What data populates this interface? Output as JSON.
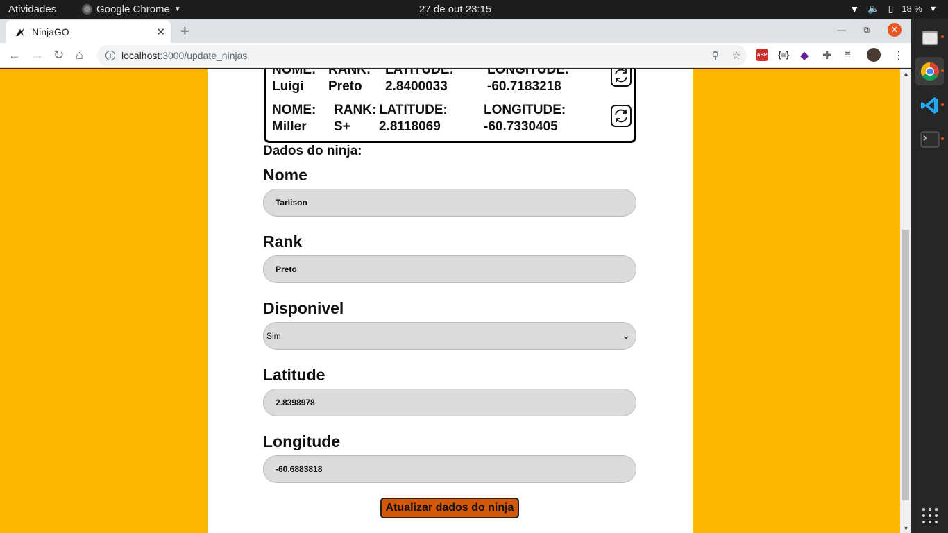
{
  "topbar": {
    "activities": "Atividades",
    "app_name": "Google Chrome",
    "clock": "27 de out  23:15",
    "battery": "18 %"
  },
  "browser": {
    "tab_title": "NinjaGO",
    "url_host": "localhost",
    "url_path": ":3000/update_ninjas"
  },
  "ninja_list": {
    "headers": {
      "name": "NOME:",
      "rank": "RANK:",
      "latitude": "LATITUDE:",
      "longitude": "LONGITUDE:"
    },
    "rows": [
      {
        "name": "Luigi",
        "rank": "Preto",
        "latitude": "2.8400033",
        "longitude": "-60.7183218"
      },
      {
        "name": "Miller",
        "rank": "S+",
        "latitude": "2.8118069",
        "longitude": "-60.7330405"
      }
    ]
  },
  "form": {
    "section_title": "Dados do ninja:",
    "nome_label": "Nome",
    "nome_value": "Tarlison",
    "rank_label": "Rank",
    "rank_value": "Preto",
    "disponivel_label": "Disponivel",
    "disponivel_value": "Sim",
    "latitude_label": "Latitude",
    "latitude_value": "2.8398978",
    "longitude_label": "Longitude",
    "longitude_value": "-60.6883818",
    "submit_label": "Atualizar dados do ninja"
  },
  "colors": {
    "page_background": "#fdb900",
    "submit_button": "#d4580a",
    "input_background": "#dcdcdc"
  }
}
